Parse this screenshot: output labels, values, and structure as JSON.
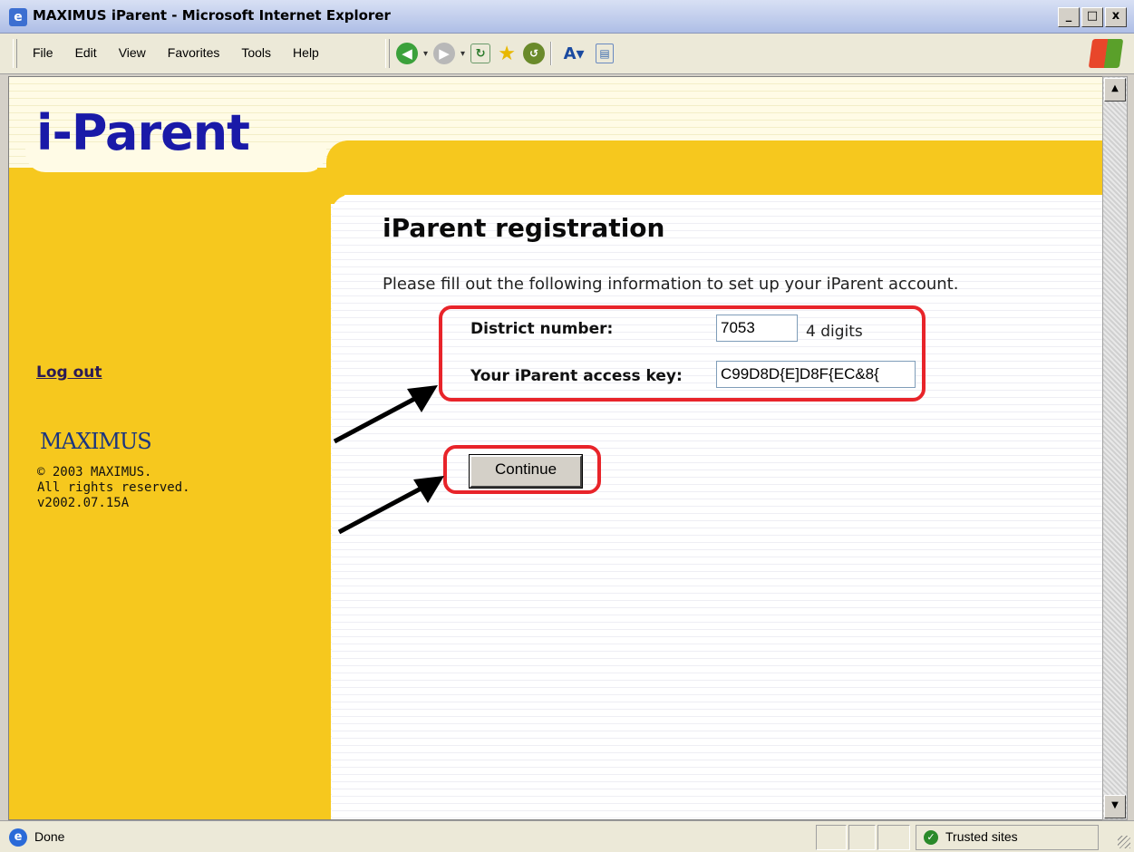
{
  "window": {
    "title": "MAXIMUS iParent - Microsoft Internet Explorer",
    "controls": [
      "_",
      "□",
      "x"
    ]
  },
  "menu": [
    "File",
    "Edit",
    "View",
    "Favorites",
    "Tools",
    "Help"
  ],
  "toolbar_icons": [
    "back-icon",
    "forward-icon",
    "refresh-icon",
    "favorites-star-icon",
    "history-icon",
    "text-size-icon",
    "page-icon"
  ],
  "site": {
    "logo_text": "i-Parent",
    "logout_label": "Log out",
    "brand": "MAXIMUS",
    "copyright": [
      "© 2003 MAXIMUS.",
      "All rights reserved.",
      "v2002.07.15A"
    ],
    "accent_color": "#f6c81e",
    "logo_color": "#1a1aa8"
  },
  "form": {
    "title": "iParent registration",
    "intro": "Please fill out the following information to set up your iParent account.",
    "district_label": "District number:",
    "district_value": "7053",
    "district_hint": "4 digits",
    "key_label": "Your iParent access key:",
    "key_value": "C99D8D{E]D8F{EC&8{",
    "continue_label": "Continue"
  },
  "annotations": {
    "highlight_color": "#e8242a"
  },
  "status": {
    "text": "Done",
    "zone": "Trusted sites"
  }
}
